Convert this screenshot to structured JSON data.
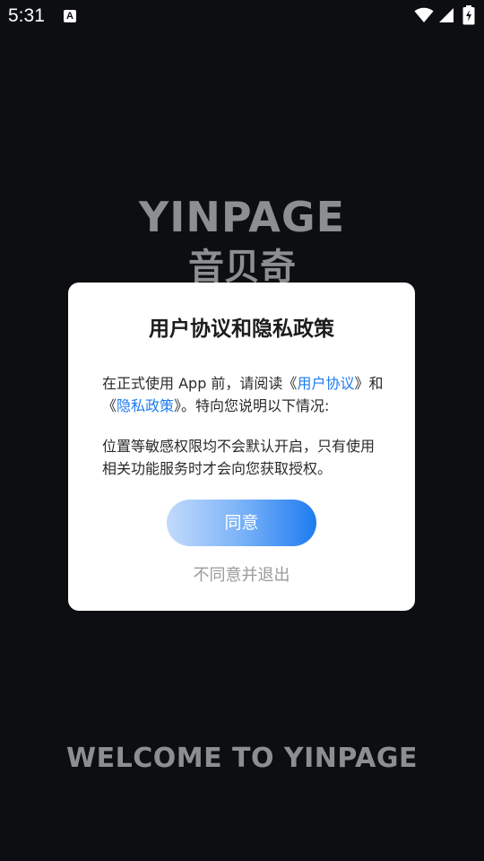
{
  "status_bar": {
    "time": "5:31",
    "notification_glyph": "A",
    "icons": [
      "wifi-icon",
      "signal-icon",
      "battery-icon"
    ]
  },
  "brand": {
    "logo_text": "YINPAGE",
    "logo_sub": "音贝奇",
    "welcome": "WELCOME TO YINPAGE"
  },
  "dialog": {
    "title": "用户协议和隐私政策",
    "para1": {
      "pre": "在正式使用 App 前，请阅读《",
      "link1": "用户协议",
      "mid": "》和《",
      "link2": "隐私政策",
      "post": "》。特向您说明以下情况:"
    },
    "para2": "位置等敏感权限均不会默认开启，只有使用相关功能服务时才会向您获取授权。",
    "agree_label": "同意",
    "disagree_label": "不同意并退出"
  },
  "colors": {
    "background": "#0c0e11",
    "brand_text": "#8d8e90",
    "link": "#1e7cf0",
    "button_gradient_start": "#c2dafb",
    "button_gradient_end": "#1e7cf0"
  }
}
